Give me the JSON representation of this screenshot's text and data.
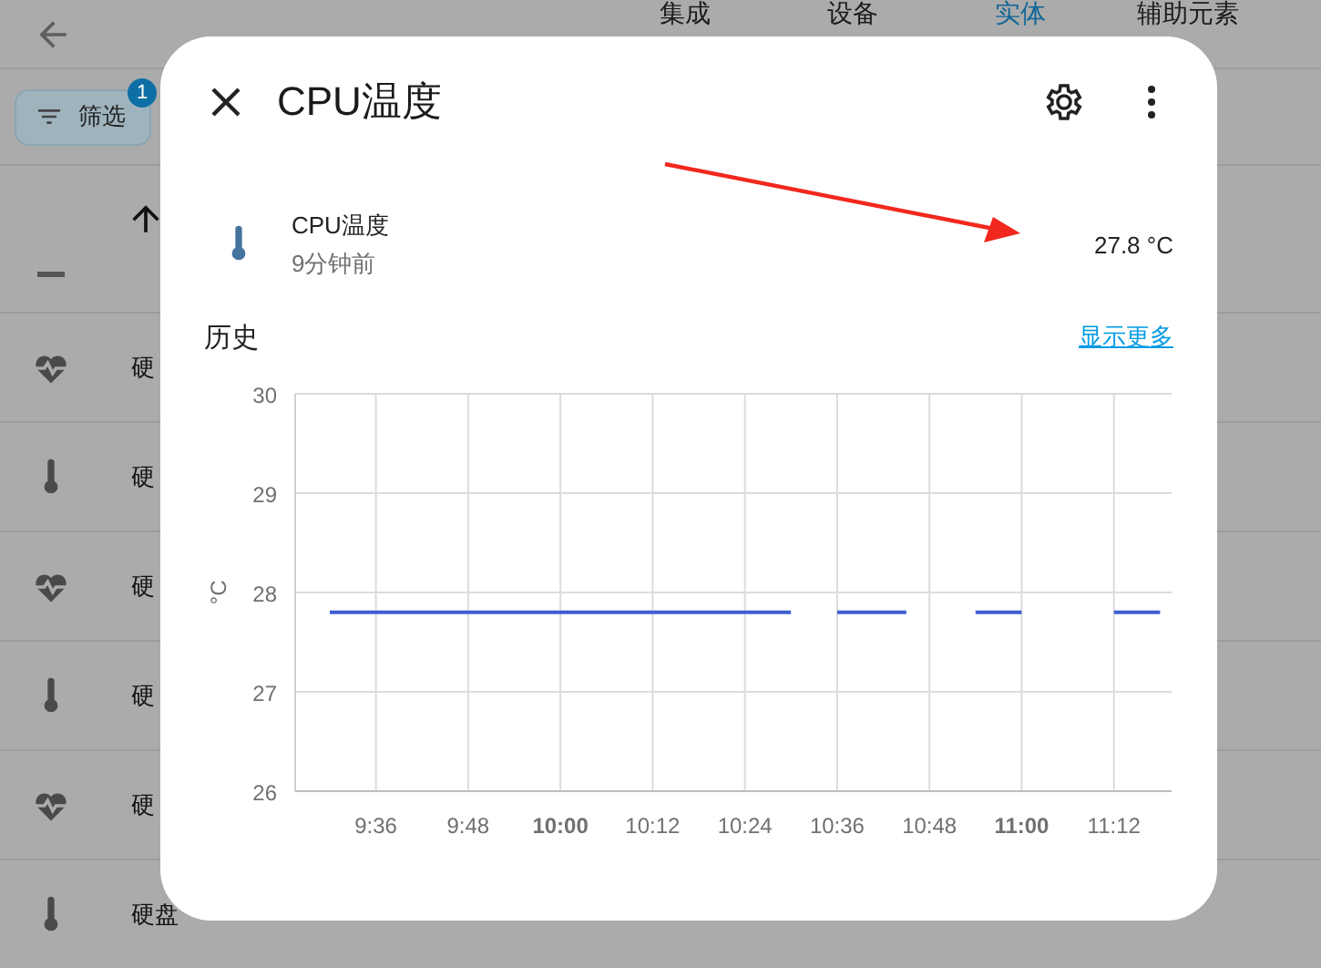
{
  "tabs": [
    {
      "label": "集成",
      "selected": false
    },
    {
      "label": "设备",
      "selected": false
    },
    {
      "label": "实体",
      "selected": true
    },
    {
      "label": "辅助元素",
      "selected": false
    }
  ],
  "filter": {
    "label": "筛选",
    "badge": "1"
  },
  "rows": [
    {
      "kind": "health",
      "text": "硬"
    },
    {
      "kind": "temperature",
      "text": "硬"
    },
    {
      "kind": "health",
      "text": "硬"
    },
    {
      "kind": "temperature",
      "text": "硬"
    },
    {
      "kind": "health",
      "text": "硬"
    },
    {
      "kind": "temperature",
      "text": "硬盘"
    }
  ],
  "dialog": {
    "title": "CPU温度",
    "entity": {
      "name": "CPU温度",
      "updated": "9分钟前",
      "state": "27.8 °C"
    },
    "history": {
      "title": "历史",
      "more": "显示更多",
      "chart_data": {
        "type": "line",
        "ylabel": "°C",
        "categories": [
          null,
          null,
          null,
          "9:36",
          null,
          null,
          null,
          "9:48",
          null,
          null,
          null,
          "10:00",
          null,
          null,
          null,
          "10:12",
          null,
          null,
          null,
          "10:24",
          null,
          null,
          null,
          "10:36",
          null,
          null,
          null,
          "10:48",
          null,
          null,
          null,
          "11:00",
          null,
          null,
          null,
          "11:12",
          null,
          null
        ],
        "series": [
          {
            "color": "#3d5fd3",
            "values": [
              null,
              27.8,
              27.8,
              27.8,
              27.8,
              27.8,
              27.8,
              27.8,
              27.8,
              27.8,
              27.8,
              27.8,
              27.8,
              27.8,
              27.8,
              27.8,
              27.8,
              27.8,
              27.8,
              27.8,
              27.8,
              27.8,
              null,
              27.8,
              27.8,
              27.8,
              27.8,
              null,
              null,
              27.8,
              27.8,
              27.8,
              null,
              null,
              null,
              27.8,
              27.8,
              27.8
            ]
          }
        ],
        "ylim": [
          26,
          30
        ],
        "grid": true,
        "yticks": [
          26,
          27,
          28,
          29,
          30
        ]
      }
    }
  }
}
